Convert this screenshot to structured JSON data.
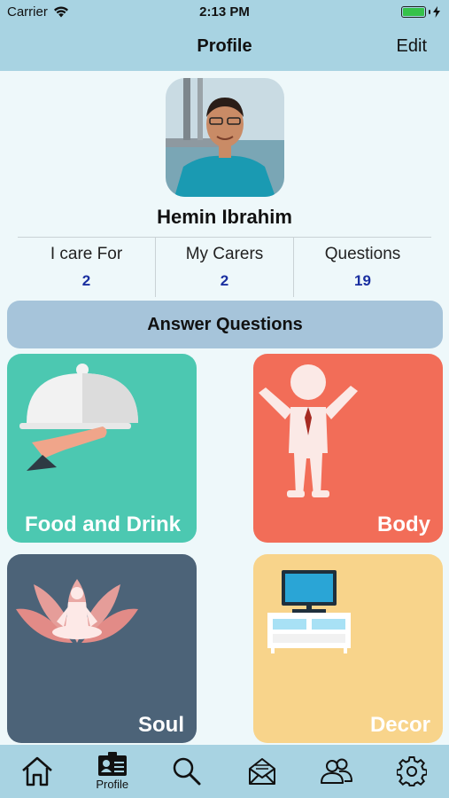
{
  "status_bar": {
    "carrier": "Carrier",
    "time": "2:13 PM"
  },
  "nav": {
    "title": "Profile",
    "edit_label": "Edit"
  },
  "profile": {
    "name": "Hemin Ibrahim",
    "stats": [
      {
        "label": "I care For",
        "value": "2"
      },
      {
        "label": "My Carers",
        "value": "2"
      },
      {
        "label": "Questions",
        "value": "19"
      }
    ]
  },
  "answer_button": "Answer Questions",
  "categories": [
    {
      "label": "Food and Drink",
      "color": "#4cc8b1",
      "icon": "serving-cloche-icon"
    },
    {
      "label": "Body",
      "color": "#f26d58",
      "icon": "body-figure-icon"
    },
    {
      "label": "Soul",
      "color": "#4c6378",
      "icon": "lotus-meditation-icon"
    },
    {
      "label": "Decor",
      "color": "#f8d48b",
      "icon": "tv-stand-icon"
    }
  ],
  "tabs": [
    {
      "name": "home",
      "icon": "home-icon",
      "label": ""
    },
    {
      "name": "profile",
      "icon": "profile-card-icon",
      "label": "Profile"
    },
    {
      "name": "search",
      "icon": "search-icon",
      "label": ""
    },
    {
      "name": "messages",
      "icon": "envelope-icon",
      "label": ""
    },
    {
      "name": "people",
      "icon": "people-icon",
      "label": ""
    },
    {
      "name": "settings",
      "icon": "gear-icon",
      "label": ""
    }
  ],
  "colors": {
    "bars": "#a8d3e2",
    "accent_value": "#1a2fa0",
    "button": "#a6c4da"
  }
}
